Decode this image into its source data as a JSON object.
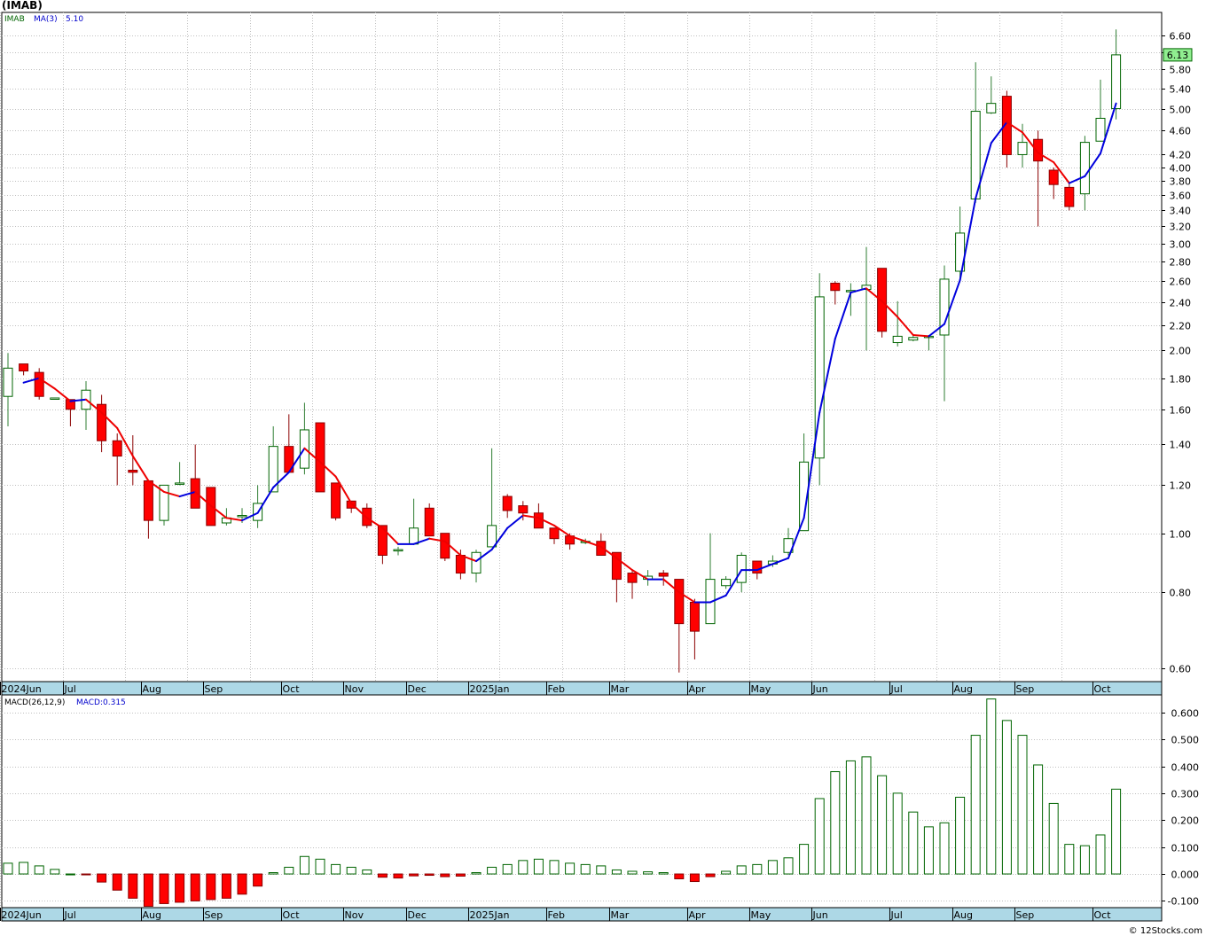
{
  "header": {
    "title": "(IMAB)"
  },
  "footer": {
    "credit": "© 12Stocks.com"
  },
  "colors": {
    "up": "#ffffff",
    "down": "#ff0000",
    "upStroke": "#006400",
    "downStroke": "#8b0000",
    "maUp": "#0000dd",
    "maDown": "#ee0000",
    "axisBand": "#add8e6",
    "grid": "#c0c0c0",
    "lastPriceBox": "#90ee90"
  },
  "chart_data": [
    {
      "type": "candlestick",
      "legend": {
        "symbol": "IMAB",
        "ma_label": "MA(3)",
        "ma_value": "5.10"
      },
      "last_price_label": "6.13",
      "y_scale": "log",
      "ylim": [
        0.57,
        7.2
      ],
      "y_ticks": [
        "6.60",
        "6.20",
        "5.80",
        "5.40",
        "5.00",
        "4.60",
        "4.20",
        "4.00",
        "3.80",
        "3.60",
        "3.40",
        "3.20",
        "3.00",
        "2.80",
        "2.60",
        "2.40",
        "2.20",
        "2.00",
        "1.80",
        "1.60",
        "1.40",
        "1.20",
        "1.00",
        "0.80",
        "0.60"
      ],
      "x_month_labels": [
        {
          "label": "2024Jun",
          "i": 0
        },
        {
          "label": "Jul",
          "i": 4
        },
        {
          "label": "Aug",
          "i": 9
        },
        {
          "label": "Sep",
          "i": 13
        },
        {
          "label": "Oct",
          "i": 18
        },
        {
          "label": "Nov",
          "i": 22
        },
        {
          "label": "Dec",
          "i": 26
        },
        {
          "label": "2025Jan",
          "i": 30
        },
        {
          "label": "Feb",
          "i": 35
        },
        {
          "label": "Mar",
          "i": 39
        },
        {
          "label": "Apr",
          "i": 44
        },
        {
          "label": "May",
          "i": 48
        },
        {
          "label": "Jun",
          "i": 52
        },
        {
          "label": "Jul",
          "i": 57
        },
        {
          "label": "Aug",
          "i": 61
        },
        {
          "label": "Sep",
          "i": 65
        },
        {
          "label": "Oct",
          "i": 70
        }
      ],
      "candles": [
        [
          1.68,
          1.87,
          1.98,
          1.5
        ],
        [
          1.9,
          1.85,
          1.9,
          1.82
        ],
        [
          1.84,
          1.68,
          1.87,
          1.66
        ],
        [
          1.67,
          1.67,
          1.67,
          1.67
        ],
        [
          1.66,
          1.6,
          1.66,
          1.5
        ],
        [
          1.6,
          1.72,
          1.78,
          1.48
        ],
        [
          1.63,
          1.42,
          1.69,
          1.36
        ],
        [
          1.42,
          1.34,
          1.46,
          1.2
        ],
        [
          1.27,
          1.26,
          1.45,
          1.2
        ],
        [
          1.22,
          1.05,
          1.22,
          0.98
        ],
        [
          1.05,
          1.2,
          1.2,
          1.03
        ],
        [
          1.21,
          1.21,
          1.31,
          1.2
        ],
        [
          1.23,
          1.1,
          1.4,
          1.1
        ],
        [
          1.19,
          1.03,
          1.19,
          1.03
        ],
        [
          1.04,
          1.06,
          1.1,
          1.03
        ],
        [
          1.07,
          1.07,
          1.1,
          1.04
        ],
        [
          1.05,
          1.12,
          1.2,
          1.02
        ],
        [
          1.17,
          1.39,
          1.5,
          1.17
        ],
        [
          1.39,
          1.26,
          1.57,
          1.26
        ],
        [
          1.28,
          1.48,
          1.64,
          1.25
        ],
        [
          1.52,
          1.17,
          1.52,
          1.17
        ],
        [
          1.21,
          1.06,
          1.21,
          1.05
        ],
        [
          1.13,
          1.1,
          1.13,
          1.08
        ],
        [
          1.1,
          1.03,
          1.12,
          1.02
        ],
        [
          1.03,
          0.92,
          1.03,
          0.89
        ],
        [
          0.94,
          0.94,
          0.95,
          0.92
        ],
        [
          0.96,
          1.02,
          1.14,
          0.96
        ],
        [
          1.1,
          0.99,
          1.12,
          0.99
        ],
        [
          1.0,
          0.91,
          1.0,
          0.9
        ],
        [
          0.92,
          0.86,
          0.94,
          0.84
        ],
        [
          0.86,
          0.93,
          0.94,
          0.83
        ],
        [
          0.95,
          1.03,
          1.38,
          0.95
        ],
        [
          1.15,
          1.09,
          1.16,
          1.06
        ],
        [
          1.11,
          1.08,
          1.13,
          1.05
        ],
        [
          1.08,
          1.02,
          1.12,
          1.02
        ],
        [
          1.02,
          0.98,
          1.02,
          0.96
        ],
        [
          0.99,
          0.96,
          1.0,
          0.94
        ],
        [
          0.97,
          0.97,
          0.98,
          0.96
        ],
        [
          0.97,
          0.92,
          1.0,
          0.92
        ],
        [
          0.93,
          0.84,
          0.93,
          0.77
        ],
        [
          0.86,
          0.83,
          0.87,
          0.78
        ],
        [
          0.84,
          0.85,
          0.87,
          0.82
        ],
        [
          0.86,
          0.85,
          0.87,
          0.82
        ],
        [
          0.84,
          0.71,
          0.84,
          0.59
        ],
        [
          0.77,
          0.69,
          0.78,
          0.62
        ],
        [
          0.71,
          0.84,
          1.0,
          0.71
        ],
        [
          0.82,
          0.84,
          0.85,
          0.81
        ],
        [
          0.83,
          0.92,
          0.93,
          0.8
        ],
        [
          0.9,
          0.86,
          0.9,
          0.84
        ],
        [
          0.89,
          0.9,
          0.92,
          0.88
        ],
        [
          0.93,
          0.98,
          1.02,
          0.92
        ],
        [
          1.01,
          1.31,
          1.46,
          1.01
        ],
        [
          1.33,
          2.45,
          2.68,
          1.2
        ],
        [
          2.58,
          2.51,
          2.6,
          2.38
        ],
        [
          2.51,
          2.51,
          2.58,
          2.28
        ],
        [
          2.52,
          2.56,
          2.96,
          2.0
        ],
        [
          2.73,
          2.15,
          2.73,
          2.1
        ],
        [
          2.06,
          2.11,
          2.41,
          2.03
        ],
        [
          2.08,
          2.1,
          2.12,
          2.07
        ],
        [
          2.11,
          2.11,
          2.12,
          2.0
        ],
        [
          2.12,
          2.62,
          2.76,
          1.65
        ],
        [
          2.7,
          3.12,
          3.45,
          2.59
        ],
        [
          3.55,
          4.95,
          5.96,
          3.5
        ],
        [
          4.92,
          5.1,
          5.65,
          4.9
        ],
        [
          5.24,
          4.2,
          5.35,
          4.0
        ],
        [
          4.2,
          4.4,
          4.72,
          4.0
        ],
        [
          4.45,
          4.1,
          4.6,
          3.2
        ],
        [
          3.96,
          3.75,
          4.0,
          3.55
        ],
        [
          3.71,
          3.45,
          3.76,
          3.4
        ],
        [
          3.62,
          4.4,
          4.51,
          3.4
        ],
        [
          4.42,
          4.82,
          5.58,
          4.42
        ],
        [
          5.0,
          6.13,
          6.75,
          4.8
        ]
      ],
      "ma3": [
        null,
        1.77,
        1.8,
        1.73,
        1.65,
        1.66,
        1.58,
        1.49,
        1.34,
        1.22,
        1.17,
        1.15,
        1.17,
        1.11,
        1.06,
        1.05,
        1.08,
        1.19,
        1.26,
        1.38,
        1.31,
        1.24,
        1.12,
        1.06,
        1.02,
        0.96,
        0.96,
        0.98,
        0.97,
        0.92,
        0.9,
        0.94,
        1.02,
        1.07,
        1.06,
        1.03,
        0.99,
        0.97,
        0.95,
        0.91,
        0.87,
        0.84,
        0.84,
        0.8,
        0.77,
        0.77,
        0.79,
        0.87,
        0.87,
        0.89,
        0.91,
        1.06,
        1.58,
        2.09,
        2.49,
        2.53,
        2.41,
        2.27,
        2.12,
        2.11,
        2.21,
        2.61,
        3.56,
        4.39,
        4.75,
        4.57,
        4.23,
        4.08,
        3.77,
        3.87,
        4.22,
        5.1
      ]
    },
    {
      "type": "bar",
      "legend": {
        "label": "MACD(26,12,9)",
        "value_label": "MACD:0.315"
      },
      "ylim": [
        -0.125,
        0.665
      ],
      "y_ticks": [
        "0.600",
        "0.500",
        "0.400",
        "0.300",
        "0.200",
        "0.100",
        "0.000",
        "-0.100"
      ],
      "values": [
        0.04,
        0.043,
        0.03,
        0.017,
        0.0,
        -0.002,
        -0.03,
        -0.06,
        -0.09,
        -0.12,
        -0.11,
        -0.105,
        -0.1,
        -0.095,
        -0.09,
        -0.075,
        -0.045,
        0.005,
        0.025,
        0.065,
        0.055,
        0.035,
        0.025,
        0.015,
        -0.012,
        -0.015,
        -0.007,
        -0.005,
        -0.01,
        -0.008,
        0.005,
        0.025,
        0.035,
        0.05,
        0.055,
        0.05,
        0.04,
        0.035,
        0.03,
        0.015,
        0.01,
        0.008,
        0.005,
        -0.018,
        -0.028,
        -0.01,
        0.01,
        0.03,
        0.035,
        0.05,
        0.06,
        0.11,
        0.28,
        0.38,
        0.42,
        0.435,
        0.365,
        0.3,
        0.23,
        0.175,
        0.19,
        0.285,
        0.515,
        0.65,
        0.57,
        0.515,
        0.405,
        0.262,
        0.11,
        0.105,
        0.145,
        0.315
      ]
    }
  ]
}
